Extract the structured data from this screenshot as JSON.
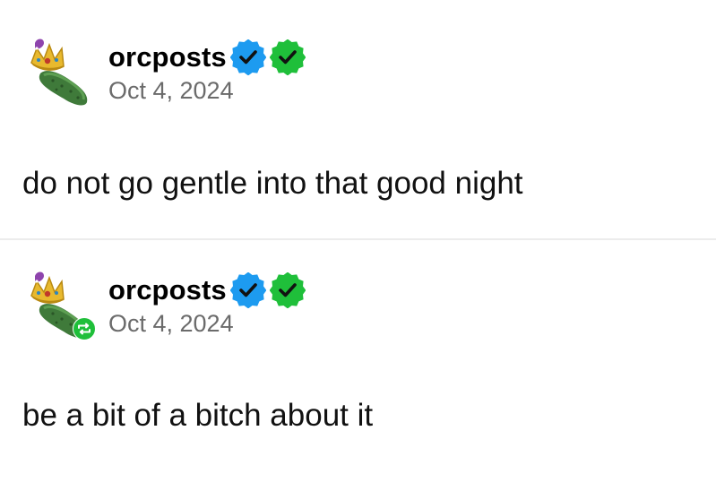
{
  "posts": [
    {
      "username": "orcposts",
      "date": "Oct 4, 2024",
      "body": "do not go gentle into that good night",
      "avatar_icon": "crowned-cucumber-icon",
      "reblogged": false
    },
    {
      "username": "orcposts",
      "date": "Oct 4, 2024",
      "body": "be a bit of a bitch about it",
      "avatar_icon": "crowned-cucumber-icon",
      "reblogged": true
    }
  ],
  "badges": [
    {
      "icon": "blue-verified-checkmark-icon",
      "color": "#1d9bf0"
    },
    {
      "icon": "green-verified-checkmark-icon",
      "color": "#1fbf3a"
    }
  ],
  "colors": {
    "reblog_badge": "#1fbf3a",
    "date_text": "#6b6b6b",
    "divider": "#ececec"
  }
}
